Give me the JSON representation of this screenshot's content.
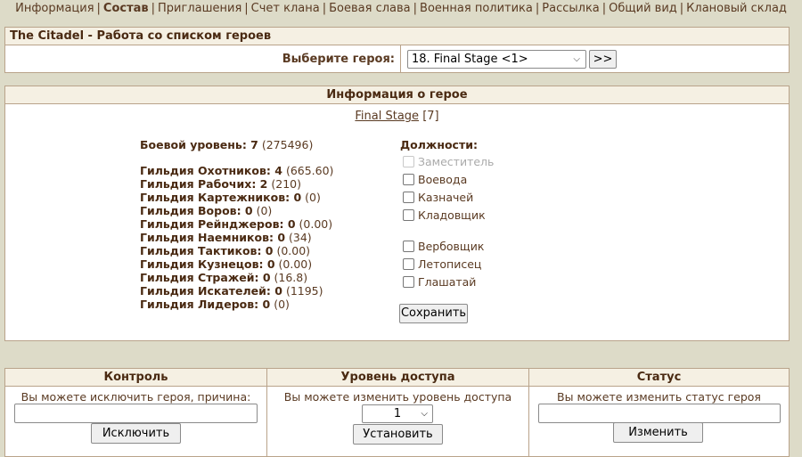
{
  "nav": {
    "items": [
      {
        "label": "Информация",
        "active": false
      },
      {
        "label": "Состав",
        "active": true
      },
      {
        "label": "Приглашения",
        "active": false
      },
      {
        "label": "Счет клана",
        "active": false
      },
      {
        "label": "Боевая слава",
        "active": false
      },
      {
        "label": "Военная политика",
        "active": false
      },
      {
        "label": "Рассылка",
        "active": false
      },
      {
        "label": "Общий вид",
        "active": false
      },
      {
        "label": "Клановый склад",
        "active": false
      }
    ]
  },
  "citadel": {
    "title": "The Citadel - Работа со списком героев",
    "choose_label": "Выберите героя:",
    "selected_hero": "18. Final Stage <1>",
    "next_label": ">>"
  },
  "hero": {
    "header": "Информация о герое",
    "name": "Final Stage",
    "level_suffix": " [7]",
    "combat_label": "Боевой уровень: 7",
    "combat_extra": " (275496)",
    "guilds": [
      {
        "label": "Гильдия Охотников: 4",
        "extra": " (665.60)"
      },
      {
        "label": "Гильдия Рабочих: 2",
        "extra": " (210)"
      },
      {
        "label": "Гильдия Картежников: 0",
        "extra": " (0)"
      },
      {
        "label": "Гильдия Воров: 0",
        "extra": " (0)"
      },
      {
        "label": "Гильдия Рейнджеров: 0",
        "extra": " (0.00)"
      },
      {
        "label": "Гильдия Наемников: 0",
        "extra": " (34)"
      },
      {
        "label": "Гильдия Тактиков: 0",
        "extra": " (0.00)"
      },
      {
        "label": "Гильдия Кузнецов: 0",
        "extra": " (0.00)"
      },
      {
        "label": "Гильдия Стражей: 0",
        "extra": " (16.8)"
      },
      {
        "label": "Гильдия Искателей: 0",
        "extra": " (1195)"
      },
      {
        "label": "Гильдия Лидеров: 0",
        "extra": " (0)"
      }
    ],
    "posts_title": "Должности:",
    "posts_group1": [
      {
        "label": "Заместитель",
        "disabled": true
      },
      {
        "label": "Воевода",
        "disabled": false
      },
      {
        "label": "Казначей",
        "disabled": false
      },
      {
        "label": "Кладовщик",
        "disabled": false
      }
    ],
    "posts_group2": [
      {
        "label": "Вербовщик",
        "disabled": false
      },
      {
        "label": "Летописец",
        "disabled": false
      },
      {
        "label": "Глашатай",
        "disabled": false
      }
    ],
    "save_label": "Сохранить"
  },
  "control": {
    "header": "Контроль",
    "desc": "Вы можете исключить героя, причина:",
    "button": "Исключить"
  },
  "access": {
    "header": "Уровень доступа",
    "desc": "Вы можете изменить уровень доступа",
    "selected": "1",
    "button": "Установить"
  },
  "status": {
    "header": "Статус",
    "desc": "Вы можете изменить статус героя",
    "button": "Изменить"
  }
}
